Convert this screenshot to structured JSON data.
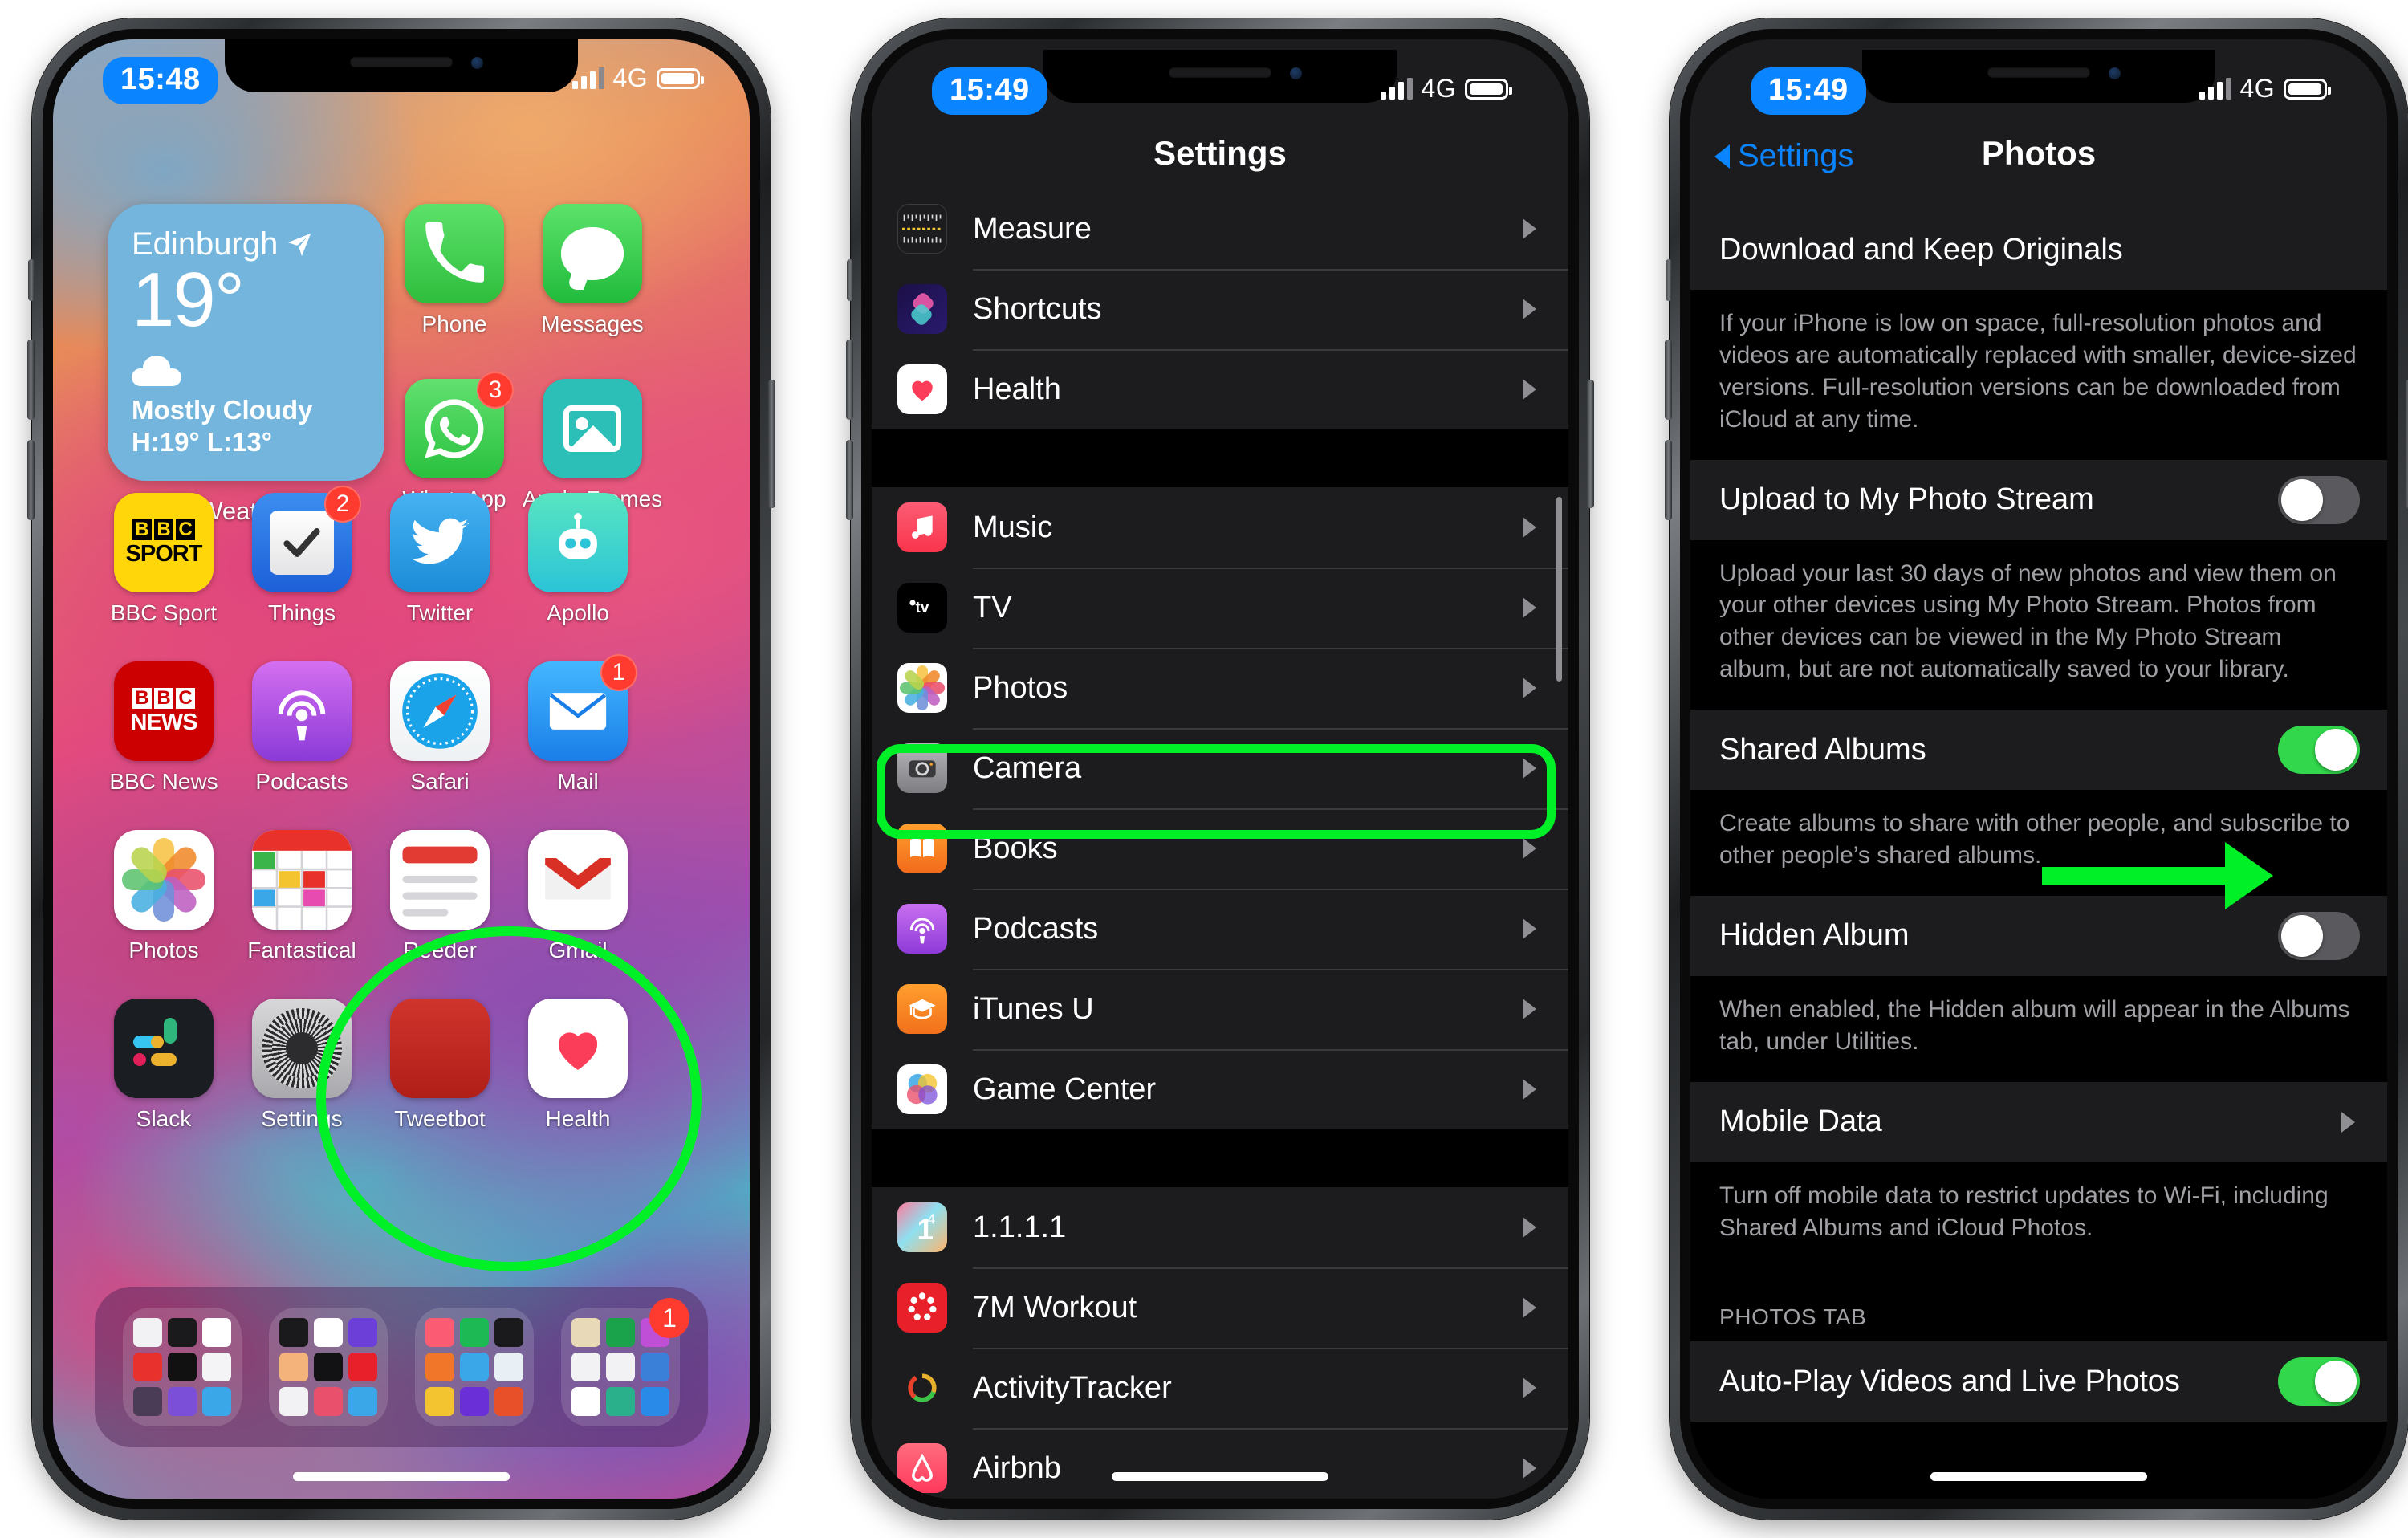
{
  "accent": {
    "green_highlight": "#00f028",
    "ios_blue": "#0a84ff",
    "toggle_on": "#32d74b",
    "badge_red": "#ff3b30"
  },
  "phone1": {
    "status": {
      "time": "15:48",
      "network": "4G"
    },
    "widget": {
      "city": "Edinburgh",
      "temperature": "19°",
      "condition": "Mostly Cloudy",
      "high_low": "H:19° L:13°",
      "app_label": "Weather"
    },
    "apps": [
      {
        "label": "Phone",
        "badge": ""
      },
      {
        "label": "Messages",
        "badge": ""
      },
      {
        "label": "WhatsApp",
        "badge": "3"
      },
      {
        "label": "Apple Frames",
        "badge": ""
      },
      {
        "label": "BBC Sport",
        "badge": ""
      },
      {
        "label": "Things",
        "badge": "2"
      },
      {
        "label": "Twitter",
        "badge": ""
      },
      {
        "label": "Apollo",
        "badge": ""
      },
      {
        "label": "BBC News",
        "badge": ""
      },
      {
        "label": "Podcasts",
        "badge": ""
      },
      {
        "label": "Safari",
        "badge": ""
      },
      {
        "label": "Mail",
        "badge": "1"
      },
      {
        "label": "Photos",
        "badge": ""
      },
      {
        "label": "Fantastical",
        "badge": ""
      },
      {
        "label": "Reeder",
        "badge": ""
      },
      {
        "label": "Gmail",
        "badge": ""
      },
      {
        "label": "Slack",
        "badge": ""
      },
      {
        "label": "Settings",
        "badge": ""
      },
      {
        "label": "Tweetbot",
        "badge": ""
      },
      {
        "label": "Health",
        "badge": ""
      }
    ],
    "bbc_sport_logo": {
      "blocks": [
        "B",
        "B",
        "C"
      ],
      "word": "SPORT"
    },
    "bbc_news_logo": {
      "blocks": [
        "B",
        "B",
        "C"
      ],
      "word": "NEWS"
    },
    "gmail_letter": "M",
    "dock_badge": "1",
    "highlighted_app": "Settings"
  },
  "phone2": {
    "status": {
      "time": "15:49",
      "network": "4G"
    },
    "title": "Settings",
    "groups": [
      {
        "items": [
          {
            "label": "Measure",
            "icon": "ruler-icon"
          },
          {
            "label": "Shortcuts",
            "icon": "shortcuts-icon"
          },
          {
            "label": "Health",
            "icon": "heart-icon"
          }
        ]
      },
      {
        "items": [
          {
            "label": "Music",
            "icon": "music-note-icon"
          },
          {
            "label": "TV",
            "icon": "apple-tv-icon"
          },
          {
            "label": "Photos",
            "icon": "photos-flower-icon",
            "highlighted": true
          },
          {
            "label": "Camera",
            "icon": "camera-icon"
          },
          {
            "label": "Books",
            "icon": "book-icon"
          },
          {
            "label": "Podcasts",
            "icon": "podcasts-icon"
          },
          {
            "label": "iTunes U",
            "icon": "graduation-cap-icon"
          },
          {
            "label": "Game Center",
            "icon": "game-center-icon"
          }
        ]
      },
      {
        "items": [
          {
            "label": "1.1.1.1",
            "icon": "cloudflare-icon"
          },
          {
            "label": "7M Workout",
            "icon": "seven-minute-icon"
          },
          {
            "label": "ActivityTracker",
            "icon": "activity-ring-icon"
          },
          {
            "label": "Airbnb",
            "icon": "airbnb-icon"
          }
        ]
      }
    ]
  },
  "phone3": {
    "status": {
      "time": "15:49",
      "network": "4G"
    },
    "back_label": "Settings",
    "title": "Photos",
    "rows": [
      {
        "label": "Download and Keep Originals",
        "type": "radio-row"
      }
    ],
    "footnote_originals": "If your iPhone is low on space, full-resolution photos and videos are automatically replaced with smaller, device-sized versions. Full-resolution versions can be downloaded from iCloud at any time.",
    "upload_stream": {
      "label": "Upload to My Photo Stream",
      "state": "off"
    },
    "footnote_stream": "Upload your last 30 days of new photos and view them on your other devices using My Photo Stream. Photos from other devices can be viewed in the My Photo Stream album, but are not automatically saved to your library.",
    "shared_albums": {
      "label": "Shared Albums",
      "state": "on"
    },
    "footnote_shared": "Create albums to share with other people, and subscribe to other people’s shared albums.",
    "hidden_album": {
      "label": "Hidden Album",
      "state": "off",
      "annotated": true
    },
    "footnote_hidden": "When enabled, the Hidden album will appear in the Albums tab, under Utilities.",
    "mobile_data": {
      "label": "Mobile Data"
    },
    "footnote_mobile": "Turn off mobile data to restrict updates to Wi-Fi, including Shared Albums and iCloud Photos.",
    "section_photos_tab": "PHOTOS TAB",
    "autoplay": {
      "label": "Auto-Play Videos and Live Photos",
      "state": "on"
    }
  }
}
